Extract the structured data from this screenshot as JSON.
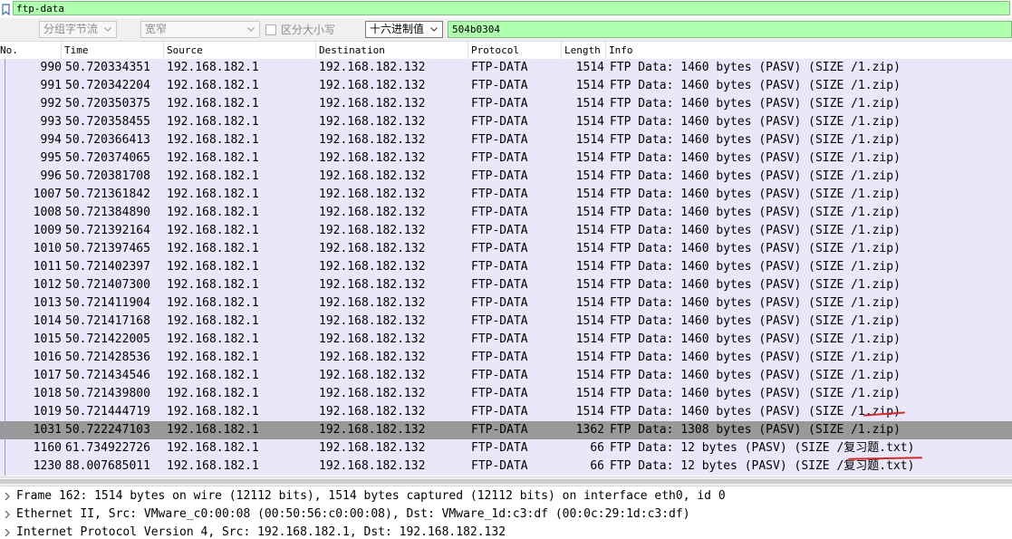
{
  "filter": {
    "value": "ftp-data"
  },
  "search_toolbar": {
    "packet_part": "分组字节流",
    "width_mode": "宽窄",
    "case_label": "区分大小写",
    "search_type": "十六进制值",
    "search_value": "504b0304"
  },
  "columns": {
    "no": "No.",
    "time": "Time",
    "source": "Source",
    "destination": "Destination",
    "protocol": "Protocol",
    "length": "Length",
    "info": "Info"
  },
  "packets": [
    {
      "no": "990",
      "time": "50.720334351",
      "src": "192.168.182.1",
      "dst": "192.168.182.132",
      "proto": "FTP-DATA",
      "len": "1514",
      "info": "FTP Data: 1460 bytes (PASV) (SIZE /1.zip)"
    },
    {
      "no": "991",
      "time": "50.720342204",
      "src": "192.168.182.1",
      "dst": "192.168.182.132",
      "proto": "FTP-DATA",
      "len": "1514",
      "info": "FTP Data: 1460 bytes (PASV) (SIZE /1.zip)"
    },
    {
      "no": "992",
      "time": "50.720350375",
      "src": "192.168.182.1",
      "dst": "192.168.182.132",
      "proto": "FTP-DATA",
      "len": "1514",
      "info": "FTP Data: 1460 bytes (PASV) (SIZE /1.zip)"
    },
    {
      "no": "993",
      "time": "50.720358455",
      "src": "192.168.182.1",
      "dst": "192.168.182.132",
      "proto": "FTP-DATA",
      "len": "1514",
      "info": "FTP Data: 1460 bytes (PASV) (SIZE /1.zip)"
    },
    {
      "no": "994",
      "time": "50.720366413",
      "src": "192.168.182.1",
      "dst": "192.168.182.132",
      "proto": "FTP-DATA",
      "len": "1514",
      "info": "FTP Data: 1460 bytes (PASV) (SIZE /1.zip)"
    },
    {
      "no": "995",
      "time": "50.720374065",
      "src": "192.168.182.1",
      "dst": "192.168.182.132",
      "proto": "FTP-DATA",
      "len": "1514",
      "info": "FTP Data: 1460 bytes (PASV) (SIZE /1.zip)"
    },
    {
      "no": "996",
      "time": "50.720381708",
      "src": "192.168.182.1",
      "dst": "192.168.182.132",
      "proto": "FTP-DATA",
      "len": "1514",
      "info": "FTP Data: 1460 bytes (PASV) (SIZE /1.zip)"
    },
    {
      "no": "1007",
      "time": "50.721361842",
      "src": "192.168.182.1",
      "dst": "192.168.182.132",
      "proto": "FTP-DATA",
      "len": "1514",
      "info": "FTP Data: 1460 bytes (PASV) (SIZE /1.zip)"
    },
    {
      "no": "1008",
      "time": "50.721384890",
      "src": "192.168.182.1",
      "dst": "192.168.182.132",
      "proto": "FTP-DATA",
      "len": "1514",
      "info": "FTP Data: 1460 bytes (PASV) (SIZE /1.zip)"
    },
    {
      "no": "1009",
      "time": "50.721392164",
      "src": "192.168.182.1",
      "dst": "192.168.182.132",
      "proto": "FTP-DATA",
      "len": "1514",
      "info": "FTP Data: 1460 bytes (PASV) (SIZE /1.zip)"
    },
    {
      "no": "1010",
      "time": "50.721397465",
      "src": "192.168.182.1",
      "dst": "192.168.182.132",
      "proto": "FTP-DATA",
      "len": "1514",
      "info": "FTP Data: 1460 bytes (PASV) (SIZE /1.zip)"
    },
    {
      "no": "1011",
      "time": "50.721402397",
      "src": "192.168.182.1",
      "dst": "192.168.182.132",
      "proto": "FTP-DATA",
      "len": "1514",
      "info": "FTP Data: 1460 bytes (PASV) (SIZE /1.zip)"
    },
    {
      "no": "1012",
      "time": "50.721407300",
      "src": "192.168.182.1",
      "dst": "192.168.182.132",
      "proto": "FTP-DATA",
      "len": "1514",
      "info": "FTP Data: 1460 bytes (PASV) (SIZE /1.zip)"
    },
    {
      "no": "1013",
      "time": "50.721411904",
      "src": "192.168.182.1",
      "dst": "192.168.182.132",
      "proto": "FTP-DATA",
      "len": "1514",
      "info": "FTP Data: 1460 bytes (PASV) (SIZE /1.zip)"
    },
    {
      "no": "1014",
      "time": "50.721417168",
      "src": "192.168.182.1",
      "dst": "192.168.182.132",
      "proto": "FTP-DATA",
      "len": "1514",
      "info": "FTP Data: 1460 bytes (PASV) (SIZE /1.zip)"
    },
    {
      "no": "1015",
      "time": "50.721422005",
      "src": "192.168.182.1",
      "dst": "192.168.182.132",
      "proto": "FTP-DATA",
      "len": "1514",
      "info": "FTP Data: 1460 bytes (PASV) (SIZE /1.zip)"
    },
    {
      "no": "1016",
      "time": "50.721428536",
      "src": "192.168.182.1",
      "dst": "192.168.182.132",
      "proto": "FTP-DATA",
      "len": "1514",
      "info": "FTP Data: 1460 bytes (PASV) (SIZE /1.zip)"
    },
    {
      "no": "1017",
      "time": "50.721434546",
      "src": "192.168.182.1",
      "dst": "192.168.182.132",
      "proto": "FTP-DATA",
      "len": "1514",
      "info": "FTP Data: 1460 bytes (PASV) (SIZE /1.zip)"
    },
    {
      "no": "1018",
      "time": "50.721439800",
      "src": "192.168.182.1",
      "dst": "192.168.182.132",
      "proto": "FTP-DATA",
      "len": "1514",
      "info": "FTP Data: 1460 bytes (PASV) (SIZE /1.zip)"
    },
    {
      "no": "1019",
      "time": "50.721444719",
      "src": "192.168.182.1",
      "dst": "192.168.182.132",
      "proto": "FTP-DATA",
      "len": "1514",
      "info": "FTP Data: 1460 bytes (PASV) (SIZE /1.zip)"
    },
    {
      "no": "1031",
      "time": "50.722247103",
      "src": "192.168.182.1",
      "dst": "192.168.182.132",
      "proto": "FTP-DATA",
      "len": "1362",
      "info": "FTP Data: 1308 bytes (PASV) (SIZE /1.zip)"
    },
    {
      "no": "1160",
      "time": "61.734922726",
      "src": "192.168.182.1",
      "dst": "192.168.182.132",
      "proto": "FTP-DATA",
      "len": "66",
      "info": "FTP Data: 12 bytes (PASV) (SIZE /复习题.txt)"
    },
    {
      "no": "1230",
      "time": "88.007685011",
      "src": "192.168.182.1",
      "dst": "192.168.182.132",
      "proto": "FTP-DATA",
      "len": "66",
      "info": "FTP Data: 12 bytes (PASV) (SIZE /复习题.txt)"
    }
  ],
  "selected_packet": "1031",
  "details": [
    "Frame 162: 1514 bytes on wire (12112 bits), 1514 bytes captured (12112 bits) on interface eth0, id 0",
    "Ethernet II, Src: VMware_c0:00:08 (00:50:56:c0:00:08), Dst: VMware_1d:c3:df (00:0c:29:1d:c3:df)",
    "Internet Protocol Version 4, Src: 192.168.182.1, Dst: 192.168.182.132"
  ],
  "icons": {
    "filter": "bookmark-icon",
    "dropdown": "chevron-down-icon",
    "expand": "chevron-right-icon"
  },
  "colors": {
    "filter_valid": "#afffaf",
    "row_ftp_data": "#e8e8fa",
    "row_selected": "#999999",
    "annotation": "#d62a2a"
  }
}
